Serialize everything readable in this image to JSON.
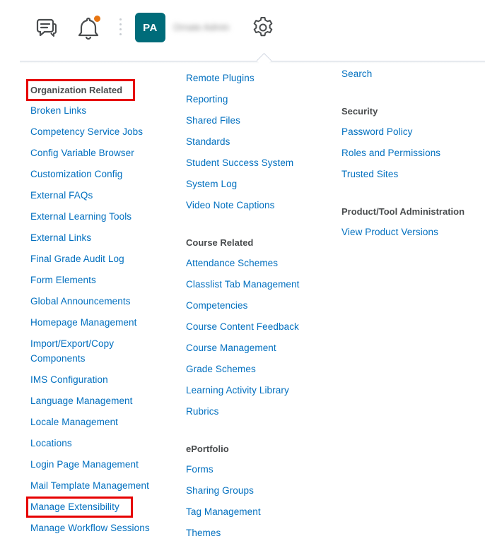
{
  "header": {
    "avatar_initials": "PA",
    "username": "Ornate Admin",
    "icons": [
      "chat-icon",
      "bell-icon",
      "gear-icon"
    ],
    "notification_dot_color": "#e87511",
    "avatar_color": "#006c7a"
  },
  "colors": {
    "link": "#006fbf",
    "heading": "#494c4e",
    "highlight": "#e60000"
  },
  "col1": {
    "heading": "Organization Related",
    "links": [
      "Broken Links",
      "Competency Service Jobs",
      "Config Variable Browser",
      "Customization Config",
      "External FAQs",
      "External Learning Tools",
      "External Links",
      "Final Grade Audit Log",
      "Form Elements",
      "Global Announcements",
      "Homepage Management",
      "Import/Export/Copy Components",
      "IMS Configuration",
      "Language Management",
      "Locale Management",
      "Locations",
      "Login Page Management",
      "Mail Template Management",
      "Manage Extensibility",
      "Manage Workflow Sessions"
    ]
  },
  "col2": {
    "links_top": [
      "Remote Plugins",
      "Reporting",
      "Shared Files",
      "Standards",
      "Student Success System",
      "System Log",
      "Video Note Captions"
    ],
    "course_heading": "Course Related",
    "course_links": [
      "Attendance Schemes",
      "Classlist Tab Management",
      "Competencies",
      "Course Content Feedback",
      "Course Management",
      "Grade Schemes",
      "Learning Activity Library",
      "Rubrics"
    ],
    "eportfolio_heading": "ePortfolio",
    "eportfolio_links": [
      "Forms",
      "Sharing Groups",
      "Tag Management",
      "Themes"
    ]
  },
  "col3": {
    "links_top": [
      "Search"
    ],
    "security_heading": "Security",
    "security_links": [
      "Password Policy",
      "Roles and Permissions",
      "Trusted Sites"
    ],
    "product_heading": "Product/Tool Administration",
    "product_links": [
      "View Product Versions"
    ]
  }
}
